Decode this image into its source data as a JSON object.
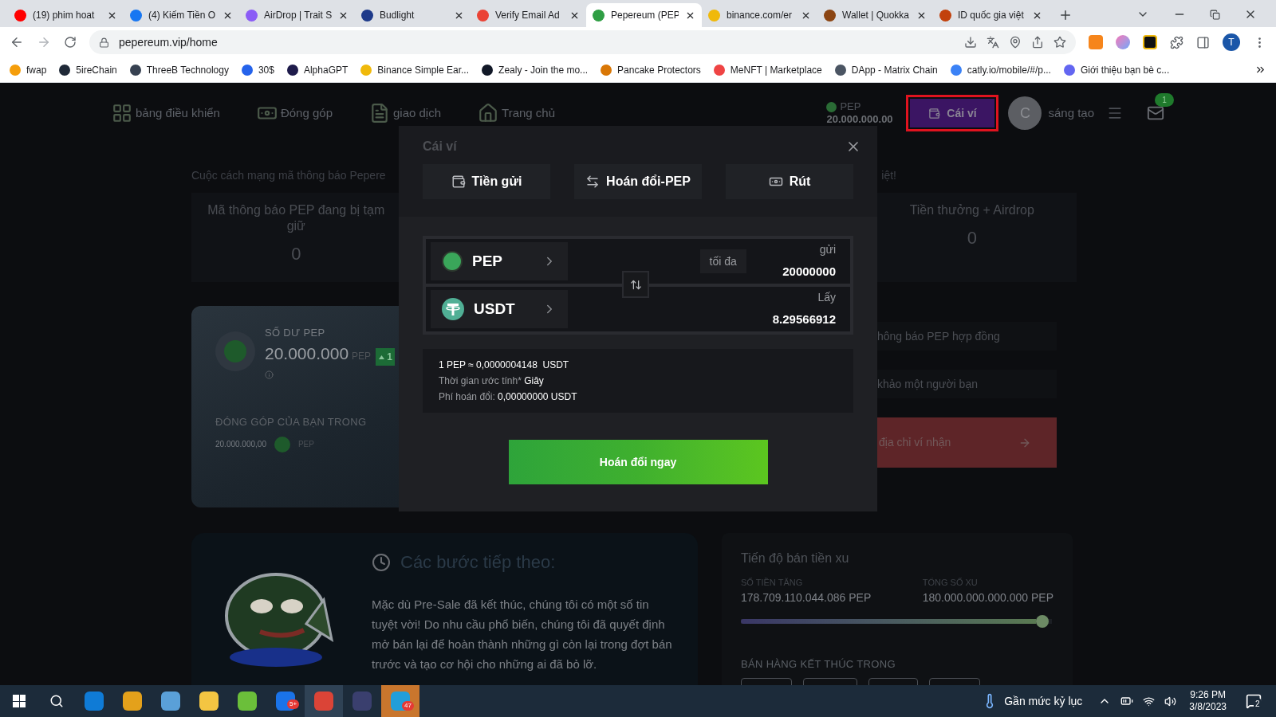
{
  "browser": {
    "tabs": [
      {
        "title": "(19) phim hoat",
        "color": "#ff0000",
        "selected": false
      },
      {
        "title": "(4) Kiếm Tiền O",
        "color": "#1877f2",
        "selected": false
      },
      {
        "title": "AirDrop | Trait S",
        "color": "#8b5cf6",
        "selected": false
      },
      {
        "title": "Budlight",
        "color": "#1e3a8a",
        "selected": false
      },
      {
        "title": "Verify Email Ad",
        "color": "#ea4335",
        "selected": false
      },
      {
        "title": "Pepereum (PEP",
        "color": "#2f9e44",
        "selected": true
      },
      {
        "title": "binance.com/er",
        "color": "#f0b90b",
        "selected": false
      },
      {
        "title": "Wallet | Quokka",
        "color": "#8b4513",
        "selected": false
      },
      {
        "title": "ID quốc gia việt",
        "color": "#c2410c",
        "selected": false
      }
    ],
    "address": "pepereum.vip/home",
    "profile": "T",
    "bookmarks": [
      {
        "label": "fwap",
        "color": "#f59e0b"
      },
      {
        "label": "5ireChain",
        "color": "#1f2937"
      },
      {
        "label": "ThreeB Technology",
        "color": "#374151"
      },
      {
        "label": "30$",
        "color": "#2563eb"
      },
      {
        "label": "AlphaGPT",
        "color": "#1e1b4b"
      },
      {
        "label": "Binance Simple Ear...",
        "color": "#f0b90b"
      },
      {
        "label": "Zealy - Join the mo...",
        "color": "#111827"
      },
      {
        "label": "Pancake Protectors",
        "color": "#d97706"
      },
      {
        "label": "MeNFT | Marketplace",
        "color": "#ef4444"
      },
      {
        "label": "DApp - Matrix Chain",
        "color": "#4b5563"
      },
      {
        "label": "catly.io/mobile/#/p...",
        "color": "#3b82f6"
      },
      {
        "label": "Giới thiệu bạn bè c...",
        "color": "#6366f1"
      }
    ]
  },
  "nav": {
    "items": [
      "bảng điều khiển",
      "Đóng góp",
      "giao dịch",
      "Trang chủ"
    ],
    "token": "PEP",
    "balance": "20.000.000.00",
    "wallet_button": "Cái ví",
    "avatar": "C",
    "username": "sáng tạo",
    "mail_badge": "1"
  },
  "page": {
    "intro_left": "Cuộc cách mạng mã thông báo Pepere",
    "intro_right": "iệt!",
    "stats": [
      {
        "label": "Mã thông báo PEP đang bị tạm giữ",
        "value": "0"
      },
      {
        "label": "Tiền thưởng + Airdrop",
        "value": "0"
      }
    ],
    "balance_card": {
      "label": "SỐ DƯ PEP",
      "amount": "20.000.000",
      "unit": "PEP",
      "badge": "1",
      "contribution_label": "ĐÓNG GÓP CỦA BẠN TRONG",
      "contribution": "20.000.000,00",
      "contribution_unit": "PEP"
    },
    "actions": [
      "hông báo PEP hợp đồng",
      "khảo một người bạn"
    ],
    "receive_button": "địa chỉ ví nhận",
    "steps": {
      "title": "Các bước tiếp theo:",
      "text": "Mặc dù Pre-Sale đã kết thúc, chúng tôi có một số tin tuyệt vời! Do nhu cầu phổ biến, chúng tôi đã quyết định mở bán lại để hoàn thành những gì còn lại trong đợt bán trước và tạo cơ hội cho những ai đã bỏ lỡ."
    },
    "progress": {
      "title": "Tiến độ bán tiền xu",
      "raised_label": "SỐ TIỀN TĂNG",
      "raised": "178.709.110.044.086 PEP",
      "total_label": "TỔNG SỐ XU",
      "total": "180.000.000.000.000 PEP",
      "level": 0.99,
      "countdown_label": "BÁN HÀNG KẾT THÚC TRONG"
    }
  },
  "modal": {
    "title": "Cái ví",
    "tabs": [
      "Tiền gửi",
      "Hoán đổi-PEP",
      "Rút"
    ],
    "from": {
      "token": "PEP",
      "max": "tối đa",
      "label": "gửi",
      "amount": "20000000"
    },
    "to": {
      "token": "USDT",
      "label": "Lấy",
      "amount": "8.29566912"
    },
    "rate_prefix": "1 PEP ≈",
    "rate": "0,0000004148  USDT",
    "time_label": "Thời gian ước tính*",
    "time": "Giây",
    "fee_label": "Phí hoán đổi:",
    "fee": "0,00000000 USDT",
    "submit": "Hoán đổi ngay"
  },
  "taskbar": {
    "zalo_badge": "5+",
    "telegram_badge": "47",
    "weather": "Gần mức kỷ lục",
    "time": "9:26 PM",
    "date": "3/8/2023",
    "notifications": "2"
  }
}
